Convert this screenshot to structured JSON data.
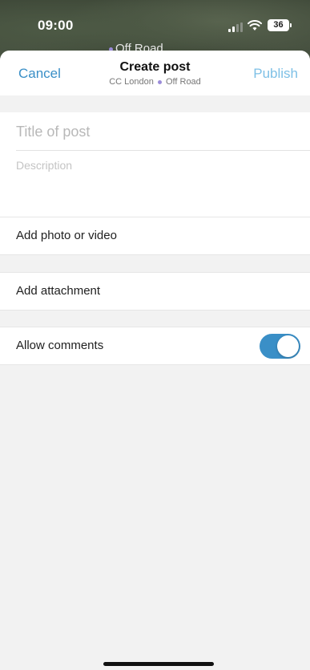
{
  "status_bar": {
    "time": "09:00",
    "battery": "36",
    "behind_title": "Off Road",
    "icons": [
      "signal-icon",
      "wifi-icon",
      "battery-icon"
    ]
  },
  "nav": {
    "cancel_label": "Cancel",
    "title": "Create post",
    "subtitle_group": "CC London",
    "subtitle_channel": "Off Road",
    "publish_label": "Publish"
  },
  "form": {
    "title_placeholder": "Title of post",
    "title_value": "",
    "description_placeholder": "Description",
    "description_value": ""
  },
  "rows": {
    "add_media_label": "Add photo or video",
    "add_attachment_label": "Add attachment",
    "allow_comments_label": "Allow comments",
    "allow_comments_enabled": true
  },
  "colors": {
    "accent": "#3a8fc7",
    "publish_disabled": "#7ec0e6",
    "channel_dot": "#9b8cd9"
  }
}
